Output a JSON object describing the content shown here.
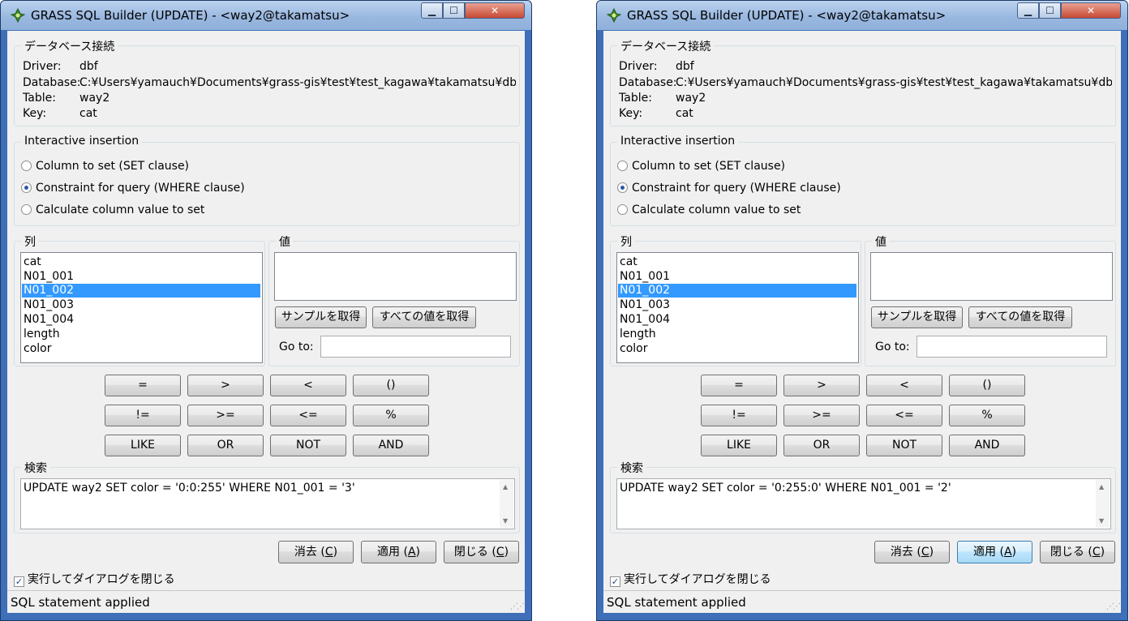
{
  "windows": [
    {
      "title": "GRASS SQL Builder (UPDATE) - <way2@takamatsu>",
      "connection": {
        "group_label": "データベース接続",
        "driver_label": "Driver:",
        "driver": "dbf",
        "database_label": "Database:",
        "database": "C:¥Users¥yamauch¥Documents¥grass-gis¥test¥test_kagawa¥takamatsu¥dbf¥",
        "table_label": "Table:",
        "table": "way2",
        "key_label": "Key:",
        "key": "cat"
      },
      "insertion": {
        "group_label": "Interactive insertion",
        "options": [
          "Column to set (SET clause)",
          "Constraint for query (WHERE clause)",
          "Calculate column value to set"
        ],
        "selected": 1
      },
      "columns": {
        "group_label": "列",
        "items": [
          "cat",
          "N01_001",
          "N01_002",
          "N01_003",
          "N01_004",
          "length",
          "color"
        ],
        "selected": 2
      },
      "values": {
        "group_label": "値",
        "sample_button": "サンプルを取得",
        "all_button": "すべての値を取得",
        "goto_label": "Go to:",
        "goto_value": ""
      },
      "operators": [
        "=",
        ">",
        "<",
        "()",
        "!=",
        ">=",
        "<=",
        "%",
        "LIKE",
        "OR",
        "NOT",
        "AND"
      ],
      "query": {
        "group_label": "検索",
        "sql": "UPDATE way2 SET color = '0:0:255' WHERE N01_001 = '3'"
      },
      "buttons": {
        "clear": "消去 (",
        "clear_key": "C",
        "apply": "適用 (",
        "apply_key": "A",
        "close": "閉じる (",
        "close_key": "C",
        "suffix": ")"
      },
      "close_after_checkbox": {
        "label": "実行してダイアログを閉じる",
        "checked": true
      },
      "status": "SQL statement applied"
    },
    {
      "title": "GRASS SQL Builder (UPDATE) - <way2@takamatsu>",
      "connection": {
        "group_label": "データベース接続",
        "driver_label": "Driver:",
        "driver": "dbf",
        "database_label": "Database:",
        "database": "C:¥Users¥yamauch¥Documents¥grass-gis¥test¥test_kagawa¥takamatsu¥dbf¥",
        "table_label": "Table:",
        "table": "way2",
        "key_label": "Key:",
        "key": "cat"
      },
      "insertion": {
        "group_label": "Interactive insertion",
        "options": [
          "Column to set (SET clause)",
          "Constraint for query (WHERE clause)",
          "Calculate column value to set"
        ],
        "selected": 1
      },
      "columns": {
        "group_label": "列",
        "items": [
          "cat",
          "N01_001",
          "N01_002",
          "N01_003",
          "N01_004",
          "length",
          "color"
        ],
        "selected": 2
      },
      "values": {
        "group_label": "値",
        "sample_button": "サンプルを取得",
        "all_button": "すべての値を取得",
        "goto_label": "Go to:",
        "goto_value": ""
      },
      "operators": [
        "=",
        ">",
        "<",
        "()",
        "!=",
        ">=",
        "<=",
        "%",
        "LIKE",
        "OR",
        "NOT",
        "AND"
      ],
      "query": {
        "group_label": "検索",
        "sql": "UPDATE way2 SET color = '0:255:0' WHERE N01_001 = '2'"
      },
      "buttons": {
        "clear": "消去 (",
        "clear_key": "C",
        "apply": "適用 (",
        "apply_key": "A",
        "close": "閉じる (",
        "close_key": "C",
        "suffix": ")"
      },
      "close_after_checkbox": {
        "label": "実行してダイアログを閉じる",
        "checked": true
      },
      "status": "SQL statement applied"
    }
  ],
  "colors": {
    "selection": "#3399ff",
    "titlebar": "#9ab8e0",
    "close_button": "#c84a33"
  },
  "icons": {
    "app": "grass-leaf-icon",
    "minimize": "minimize-icon",
    "maximize": "maximize-icon",
    "close": "close-icon"
  }
}
